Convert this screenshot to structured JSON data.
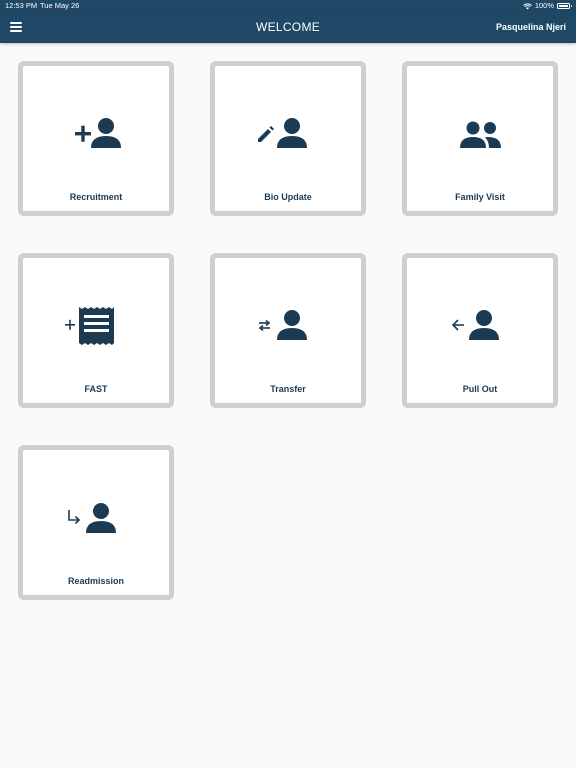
{
  "status_bar": {
    "time": "12:53 PM",
    "date": "Tue May 26",
    "battery": "100%"
  },
  "header": {
    "title": "WELCOME",
    "user_name": "Pasquelina Njeri"
  },
  "tiles": [
    {
      "label": "Recruitment",
      "icon": "add-person-icon"
    },
    {
      "label": "Bio Update",
      "icon": "edit-person-icon"
    },
    {
      "label": "Family Visit",
      "icon": "group-icon"
    },
    {
      "label": "FAST",
      "icon": "add-receipt-icon"
    },
    {
      "label": "Transfer",
      "icon": "transfer-person-icon"
    },
    {
      "label": "Pull Out",
      "icon": "pull-out-person-icon"
    },
    {
      "label": "Readmission",
      "icon": "readmission-person-icon"
    }
  ],
  "colors": {
    "header_bg": "#1f4866",
    "icon": "#1c3a52",
    "tile_border": "#cfcfcf",
    "background": "#fafafa"
  }
}
